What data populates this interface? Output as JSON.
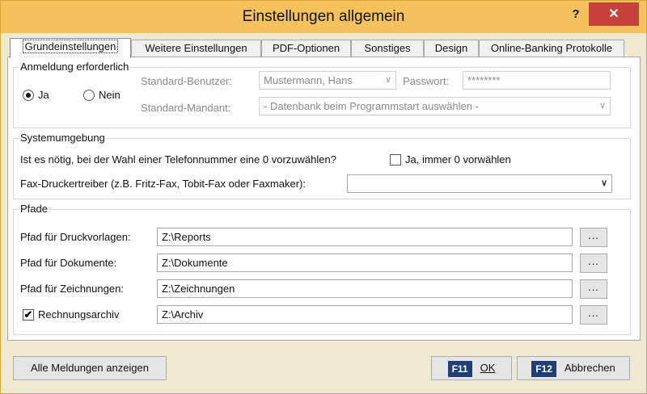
{
  "window": {
    "title": "Einstellungen allgemein",
    "help": "?",
    "close": "✕"
  },
  "tabs": [
    {
      "label": "Grundeinstellungen"
    },
    {
      "label": "Weitere Einstellungen"
    },
    {
      "label": "PDF-Optionen"
    },
    {
      "label": "Sonstiges"
    },
    {
      "label": "Design"
    },
    {
      "label": "Online-Banking Protokolle"
    }
  ],
  "login": {
    "legend": "Anmeldung erforderlich",
    "yes_label": "Ja",
    "no_label": "Nein",
    "selected": "Ja",
    "user_label": "Standard-Benutzer:",
    "user_value": "Mustermann, Hans",
    "password_label": "Passwort:",
    "password_value": "********",
    "tenant_label": "Standard-Mandant:",
    "tenant_value": "- Datenbank beim Programmstart auswählen -"
  },
  "system": {
    "legend": "Systemumgebung",
    "phone_question": "Ist es nötig, bei der Wahl einer Telefonnummer eine 0 vorzuwählen?",
    "phone_checkbox_label": "Ja, immer 0 vorwählen",
    "phone_checked": false,
    "fax_label": "Fax-Druckertreiber (z.B. Fritz-Fax, Tobit-Fax oder Faxmaker):",
    "fax_value": ""
  },
  "paths": {
    "legend": "Pfade",
    "rows": [
      {
        "label": "Pfad für Druckvorlagen:",
        "value": "Z:\\Reports"
      },
      {
        "label": "Pfad für Dokumente:",
        "value": "Z:\\Dokumente"
      },
      {
        "label": "Pfad für Zeichnungen:",
        "value": "Z:\\Zeichnungen"
      },
      {
        "label": "Rechnungsarchiv",
        "value": "Z:\\Archiv",
        "checked": true
      }
    ],
    "browse_label": "..."
  },
  "footer": {
    "show_messages": "Alle Meldungen anzeigen",
    "ok_key": "F11",
    "ok_label": "OK",
    "cancel_key": "F12",
    "cancel_label": "Abbrechen"
  },
  "icons": {
    "dropdown": "chevron-down-icon",
    "checkmark": "checkmark-icon"
  }
}
